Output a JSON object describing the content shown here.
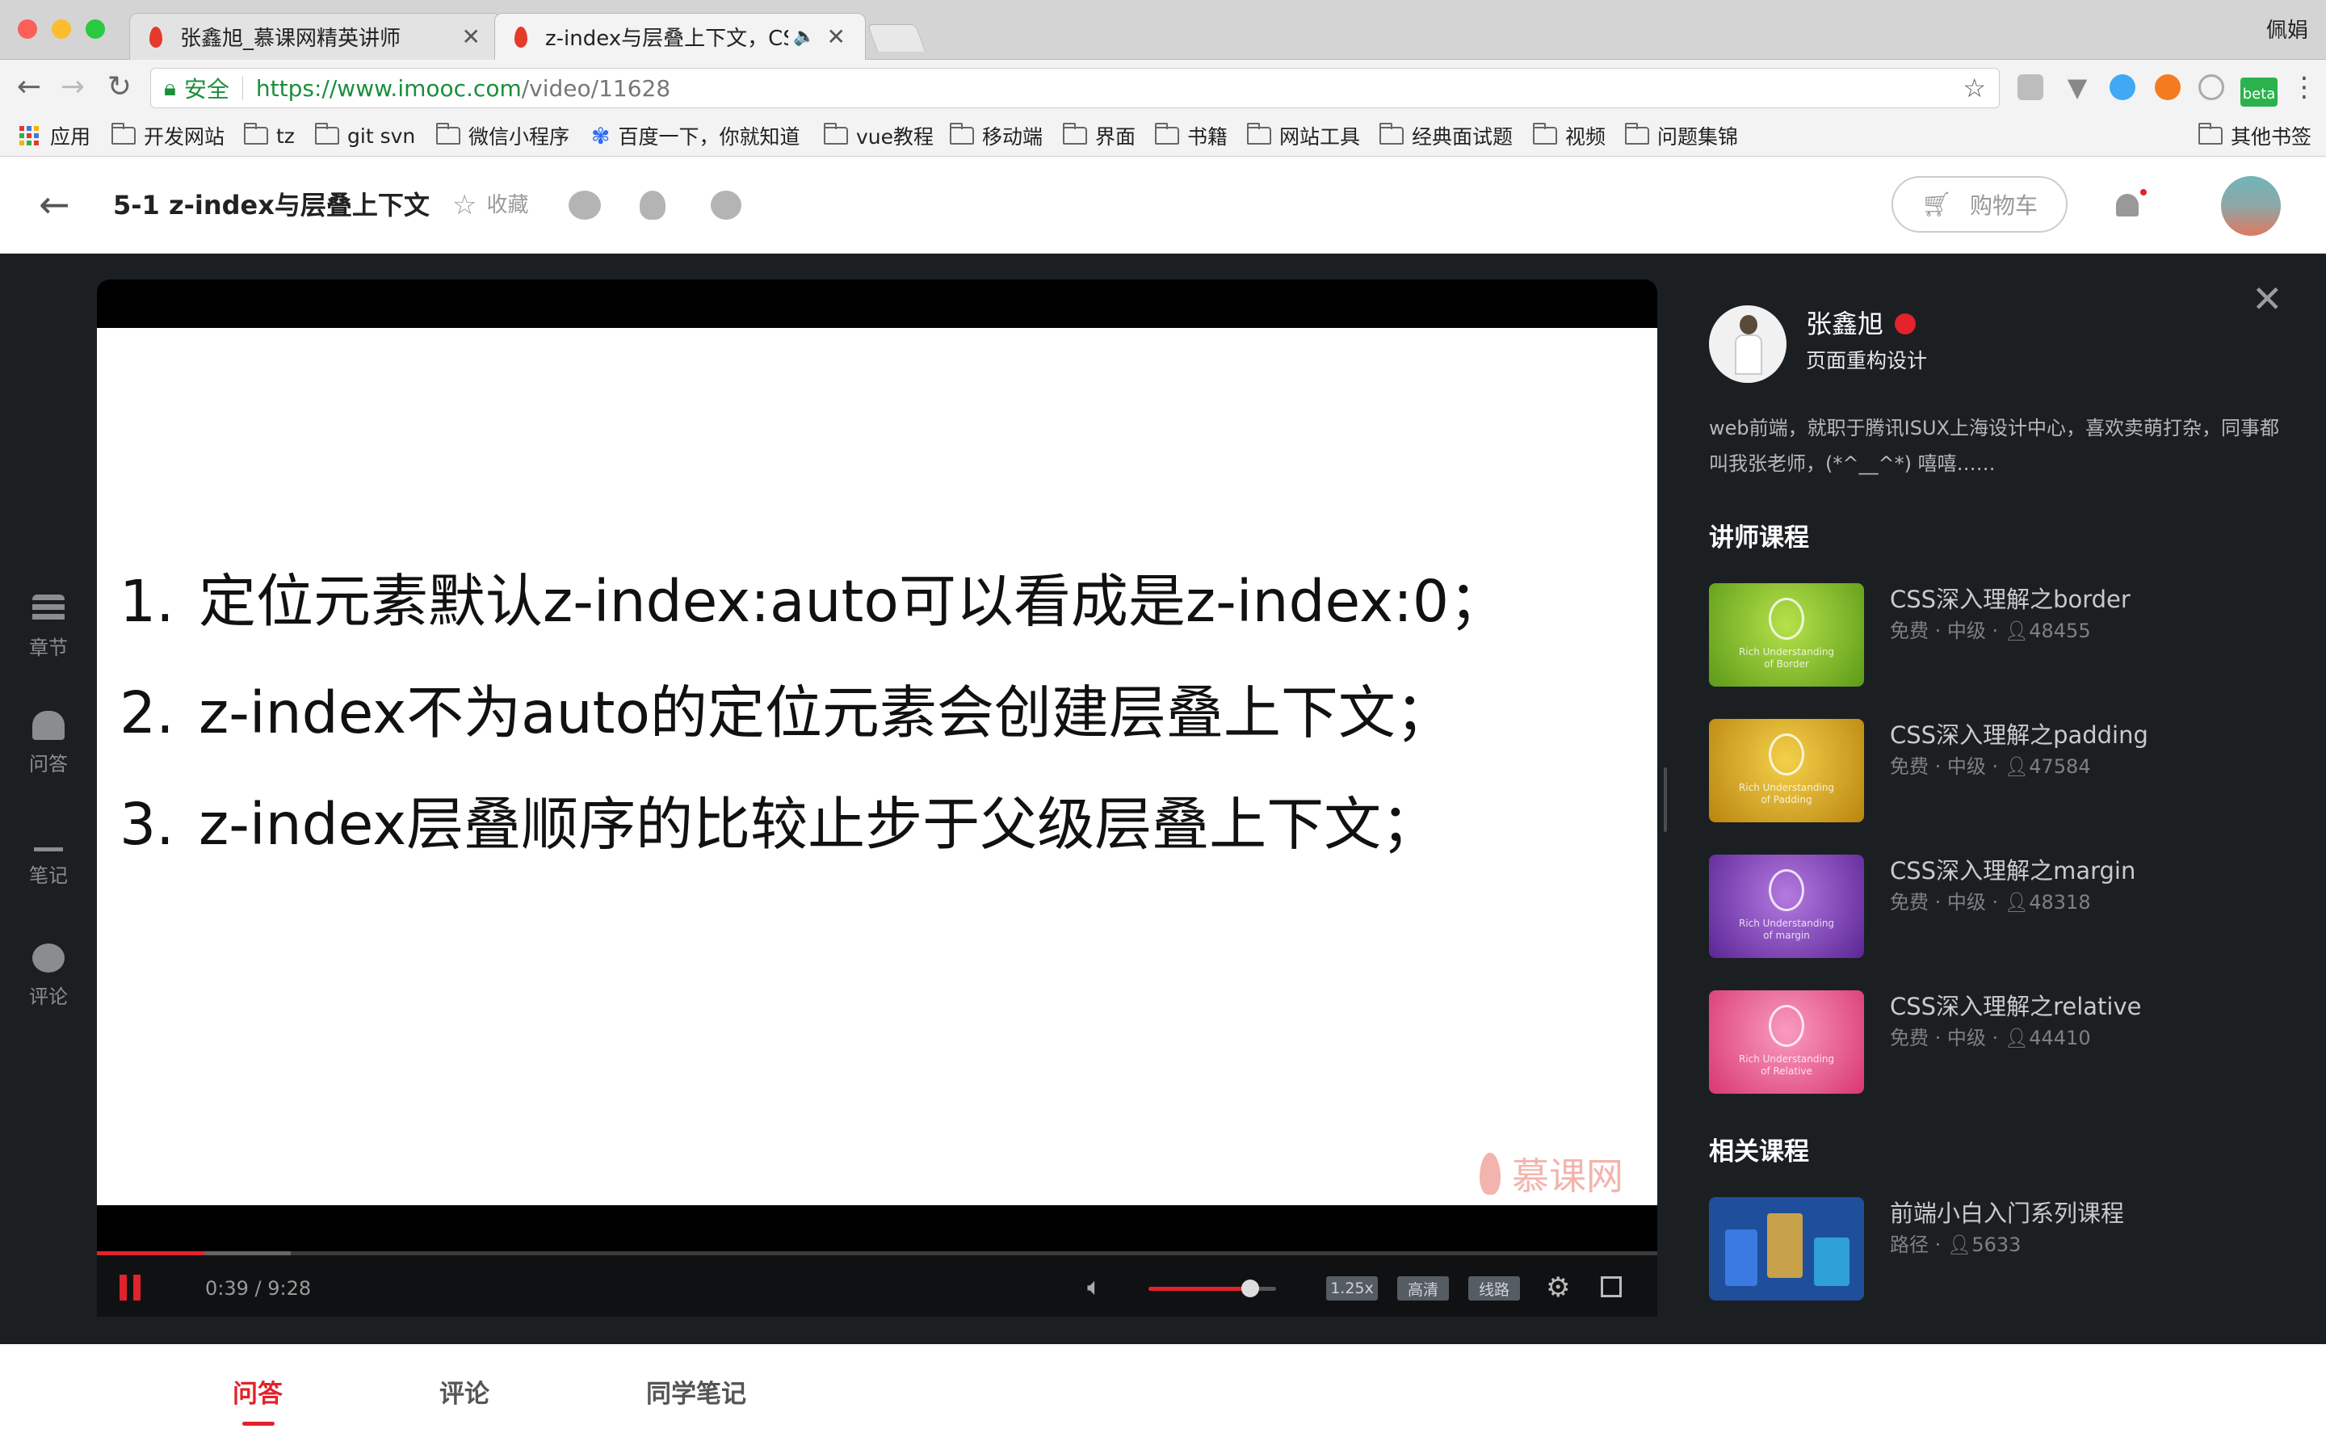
{
  "browser": {
    "tabs": [
      {
        "title": "张鑫旭_慕课网精英讲师",
        "active": false
      },
      {
        "title": "z-index与层叠上下文，CSS深入理解之z-index",
        "active": true
      }
    ],
    "profile_name": "佩娟",
    "address": {
      "secure_label": "安全",
      "url_host": "https://www.imooc.com",
      "url_path": "/video/11628"
    },
    "bookmarks": [
      "应用",
      "开发网站",
      "tz",
      "git svn",
      "微信小程序",
      "百度一下，你就知道",
      "vue教程",
      "移动端",
      "界面",
      "书籍",
      "网站工具",
      "经典面试题",
      "视频",
      "问题集锦"
    ],
    "other_bookmarks": "其他书签",
    "extension_badge": "beta"
  },
  "header": {
    "lesson_title": "5-1 z-index与层叠上下文",
    "favorite_label": "收藏",
    "cart_label": "购物车"
  },
  "sidebar": {
    "items": [
      {
        "label": "章节",
        "icon": "list-icon"
      },
      {
        "label": "问答",
        "icon": "qa-icon"
      },
      {
        "label": "笔记",
        "icon": "pen-icon"
      },
      {
        "label": "评论",
        "icon": "comment-icon"
      }
    ]
  },
  "video": {
    "slide_lines": [
      {
        "num": "1.",
        "text": "定位元素默认z-index:auto可以看成是z-index:0；"
      },
      {
        "num": "2.",
        "text": "z-index不为auto的定位元素会创建层叠上下文；"
      },
      {
        "num": "3.",
        "text": "z-index层叠顺序的比较止步于父级层叠上下文；"
      }
    ],
    "watermark": "慕课网",
    "current_time": "0:39",
    "duration": "9:28",
    "time_display": "0:39 / 9:28",
    "progress": 0.069,
    "volume": 0.8,
    "speed_label": "1.25x",
    "quality_label": "高清",
    "line_label": "线路",
    "accent_color": "#e3222b"
  },
  "teacher": {
    "name": "张鑫旭",
    "role": "页面重构设计",
    "bio": "web前端，就职于腾讯ISUX上海设计中心，喜欢卖萌打杂，同事都叫我张老师，(*^__^*) 嘻嘻……"
  },
  "teacher_courses_title": "讲师课程",
  "teacher_courses": [
    {
      "title": "CSS深入理解之border",
      "price": "免费",
      "level": "中级",
      "students": "48455",
      "thumb_caption_1": "Rich Understanding",
      "thumb_caption_2": "of Border",
      "color": "#7bb526"
    },
    {
      "title": "CSS深入理解之padding",
      "price": "免费",
      "level": "中级",
      "students": "47584",
      "thumb_caption_1": "Rich Understanding",
      "thumb_caption_2": "of Padding",
      "color": "#d9a01a"
    },
    {
      "title": "CSS深入理解之margin",
      "price": "免费",
      "level": "中级",
      "students": "48318",
      "thumb_caption_1": "Rich Understanding",
      "thumb_caption_2": "of margin",
      "color": "#7a3fb0"
    },
    {
      "title": "CSS深入理解之relative",
      "price": "免费",
      "level": "中级",
      "students": "44410",
      "thumb_caption_1": "Rich Understanding",
      "thumb_caption_2": "of Relative",
      "color": "#e4508a"
    }
  ],
  "related_title": "相关课程",
  "related_courses": [
    {
      "title": "前端小白入门系列课程",
      "type": "路径",
      "students": "5633"
    }
  ],
  "bottom_tabs": [
    "问答",
    "评论",
    "同学笔记"
  ]
}
